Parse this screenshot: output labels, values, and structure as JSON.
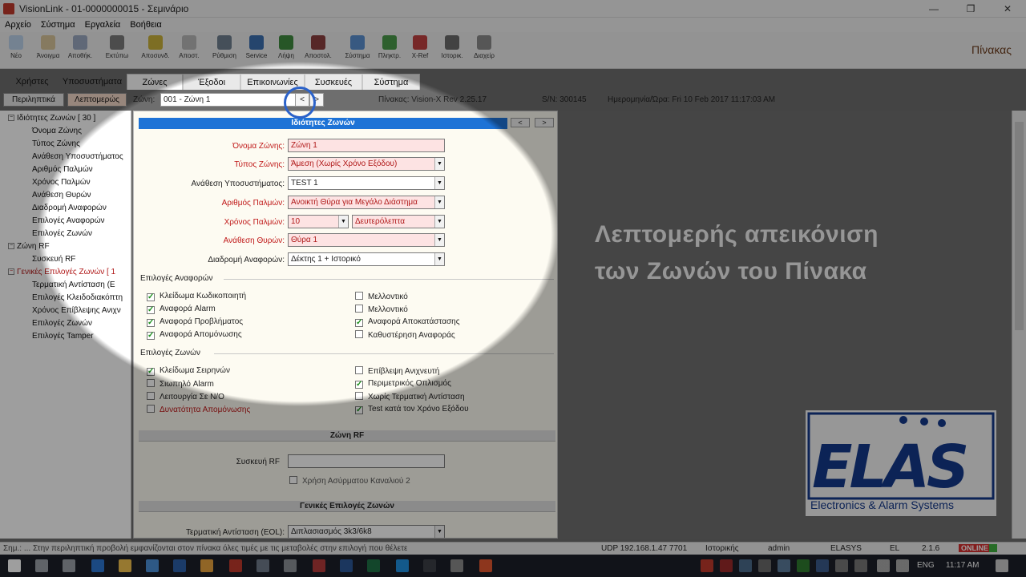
{
  "window": {
    "title": "VisionLink - 01-0000000015 - Σεμινάριο",
    "controls": [
      "—",
      "❐",
      "✕"
    ]
  },
  "menu": [
    "Αρχείο",
    "Σύστημα",
    "Εργαλεία",
    "Βοήθεια"
  ],
  "toolbar": {
    "buttons": [
      "Νέο",
      "Άνοιγμα",
      "Αποθήκ.",
      "Εκτύπω",
      "Αποσυνδ.",
      "Αποστ.",
      "Ρύθμιση",
      "Service",
      "Λήψη",
      "Αποστολ.",
      "Σύστημα",
      "Πληκτρ.",
      "X-Ref",
      "Ιστορικ.",
      "Διαχείρ"
    ],
    "panel_title": "Πίνακας"
  },
  "tabs": [
    "Χρήστες",
    "Υποσυστήματα",
    "Ζώνες",
    "Έξοδοι",
    "Επικοινωνίες",
    "Συσκευές",
    "Σύστημα"
  ],
  "row2": {
    "view_simple": "Περιληπτικά",
    "view_detail": "Λεπτομερώς",
    "zone_label": "Ζώνη:",
    "zone_value": "001 - Ζώνη 1",
    "prev": "<",
    "next": ">",
    "panel_info": "Πίνακας: Vision-X Rev 2.25.17",
    "serial": "S/N: 300145",
    "datetime": "Ημερομηνία/Ώρα: Fri 10 Feb 2017 11:17:03 AM"
  },
  "tree": [
    {
      "text": "Ιδιότητες Ζωνών [ 30 ]",
      "toggle": "−",
      "kind": "group"
    },
    {
      "text": "Όνομα Ζώνης"
    },
    {
      "text": "Τύπος Ζώνης"
    },
    {
      "text": "Ανάθεση Υποσυστήματος"
    },
    {
      "text": "Αριθμός Παλμών"
    },
    {
      "text": "Χρόνος Παλμών"
    },
    {
      "text": "Ανάθεση Θυρών"
    },
    {
      "text": "Διαδρομή Αναφορών"
    },
    {
      "text": "Επιλογές Αναφορών"
    },
    {
      "text": "Επιλογές Ζωνών"
    },
    {
      "text": "Ζώνη RF",
      "toggle": "−",
      "kind": "group"
    },
    {
      "text": "Συσκευή RF"
    },
    {
      "text": "Γενικές Επιλογές Ζωνών [ 1",
      "toggle": "−",
      "kind": "group-red"
    },
    {
      "text": "Τερματική Αντίσταση (E"
    },
    {
      "text": "Επιλογές Κλειδοδιακόπτη"
    },
    {
      "text": "Χρόνος Επίβλεψης Ανιχν"
    },
    {
      "text": "Επιλογές Ζωνών"
    },
    {
      "text": "Επιλογές Tamper"
    }
  ],
  "main": {
    "section_title": "Ιδιότητες Ζωνών",
    "fields": {
      "name": {
        "label": "Όνομα Ζώνης:",
        "value": "Ζώνη 1"
      },
      "type": {
        "label": "Τύπος Ζώνης:",
        "value": "Άμεση (Χωρίς Χρόνο Εξόδου)"
      },
      "partition": {
        "label": "Ανάθεση Υποσυστήματος:",
        "value": "TEST 1"
      },
      "pulses": {
        "label": "Αριθμός Παλμών:",
        "value": "Ανοικτή Θύρα για Μεγάλο Διάστημα"
      },
      "pulse_time": {
        "label": "Χρόνος Παλμών:",
        "value": "10",
        "unit": "Δευτερόλεπτα"
      },
      "doors": {
        "label": "Ανάθεση Θυρών:",
        "value": "Θύρα 1"
      },
      "routing": {
        "label": "Διαδρομή Αναφορών:",
        "value": "Δέκτης 1 + Ιστορικό"
      }
    },
    "report_options": {
      "title": "Επιλογές Αναφορών",
      "left": [
        {
          "label": "Κλείδωμα Κωδικοποιητή",
          "checked": true
        },
        {
          "label": "Αναφορά Alarm",
          "checked": true
        },
        {
          "label": "Αναφορά Προβλήματος",
          "checked": true
        },
        {
          "label": "Αναφορά Απομόνωσης",
          "checked": true
        }
      ],
      "right": [
        {
          "label": "Μελλοντικό",
          "checked": false
        },
        {
          "label": "Μελλοντικό",
          "checked": false
        },
        {
          "label": "Αναφορά Αποκατάστασης",
          "checked": true
        },
        {
          "label": "Καθυστέρηση Αναφοράς",
          "checked": false
        }
      ]
    },
    "zone_options": {
      "title": "Επιλογές Ζωνών",
      "left": [
        {
          "label": "Κλείδωμα Σειρηνών",
          "checked": true,
          "red": false
        },
        {
          "label": "Σιωπηλό Alarm",
          "checked": false,
          "red": false
        },
        {
          "label": "Λειτουργία Σε N/O",
          "checked": false,
          "red": false
        },
        {
          "label": "Δυνατότητα Απομόνωσης",
          "checked": false,
          "red": true
        }
      ],
      "right": [
        {
          "label": "Επίβλεψη Ανιχνευτή",
          "checked": false
        },
        {
          "label": "Περιμετρικός Οπλισμός",
          "checked": true
        },
        {
          "label": "Χωρίς Τερματική Αντίσταση",
          "checked": false
        },
        {
          "label": "Test κατά τον Χρόνο Εξόδου",
          "checked": true
        }
      ]
    },
    "rf": {
      "title": "Ζώνη RF",
      "device_label": "Συσκευή RF",
      "device_value": "",
      "aux": "Χρήση Ασύρματου Καναλιού 2"
    },
    "general": {
      "title": "Γενικές Επιλογές Ζωνών",
      "eol_label": "Τερματική Αντίσταση (EOL):",
      "eol_value": "Διπλασιασμός 3k3/6k8"
    }
  },
  "overlay": {
    "line1": "Λεπτομερής απεικόνιση",
    "line2": "των Ζωνών του Πίνακα"
  },
  "logo": {
    "text": "ELAS",
    "tagline": "Electronics & Alarm Systems"
  },
  "status": {
    "hint": "Σημ.: ... Στην περιληπτική προβολή εμφανίζονται στον πίνακα όλες τιμές με τις μεταβολές στην επιλογή που θέλετε",
    "udp": "UDP 192.168.1.47 7701",
    "conn": "Ιστορικής",
    "user": "admin",
    "brand": "ELASYS",
    "lang": "EL",
    "ver": "2.1.6",
    "online": "ONLINE"
  },
  "taskbar": {
    "lang": "ENG",
    "time": "11:17 AM"
  },
  "colors": {
    "accent": "#1e73d6",
    "required": "#c01818",
    "online": "#d32f2f",
    "logo_blue": "#14388a"
  }
}
